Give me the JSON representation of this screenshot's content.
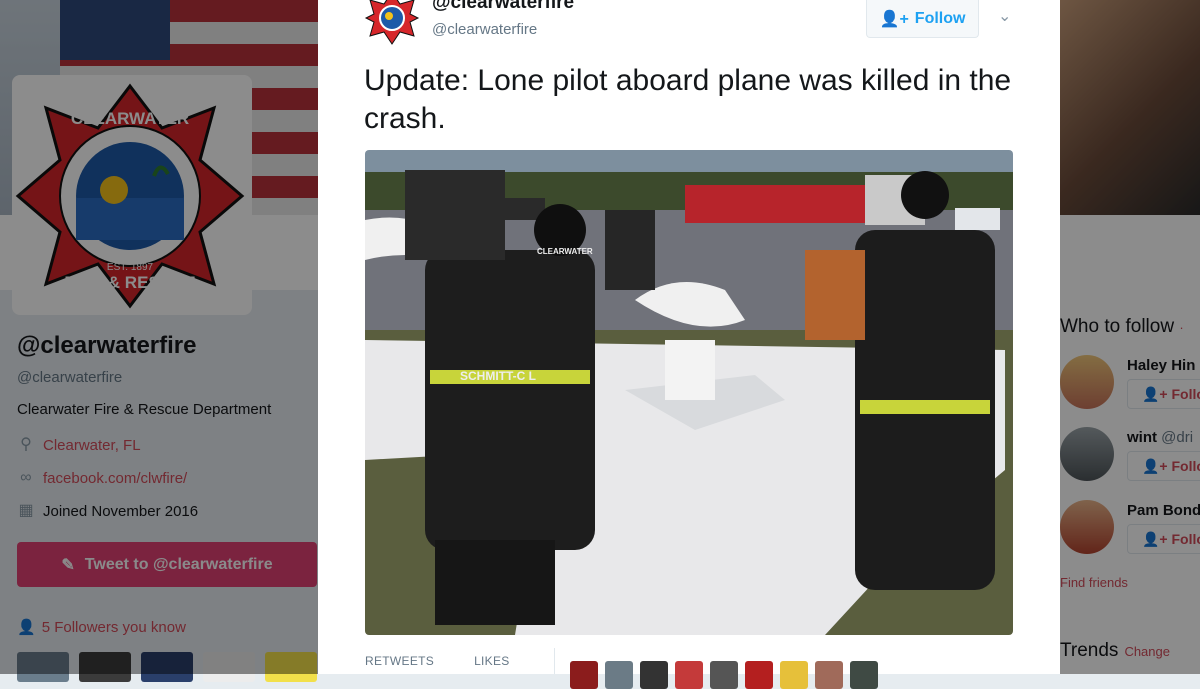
{
  "profile": {
    "name": "@clearwaterfire",
    "handle": "@clearwaterfire",
    "bio": "Clearwater Fire & Rescue Department",
    "location": "Clearwater, FL",
    "website": "facebook.com/clwfire/",
    "joined": "Joined November 2016",
    "tweet_to": "Tweet to @clearwaterfire",
    "followers_you_know": "5 Followers you know"
  },
  "logo": {
    "top_text": "CLEARWATER",
    "est": "EST. 1897",
    "bottom_text": "FIRE & RESCUE"
  },
  "sidebar": {
    "who_to_follow": "Who to follow",
    "who_to_follow_link": "·",
    "suggestions": [
      {
        "name": "Haley Hin",
        "handle": "",
        "follow": "Follo"
      },
      {
        "name": "wint",
        "handle": "@dri",
        "follow": "Follo"
      },
      {
        "name": "Pam Bond",
        "handle": "",
        "follow": "Follo"
      }
    ],
    "find_friends": "Find friends",
    "trends": "Trends",
    "trends_change": "Change"
  },
  "tweet": {
    "name": "@clearwaterfire",
    "handle": "@clearwaterfire",
    "follow_label": "Follow",
    "text": "Update: Lone pilot aboard plane was killed in the crash.",
    "photo_labels": {
      "helmet_name": "CLEARWATER",
      "jacket_name": "SCHMITT-C L"
    },
    "stats": {
      "retweets_label": "RETWEETS",
      "likes_label": "LIKES"
    }
  },
  "colors": {
    "accent": "#e0245e",
    "link": "#d14b5a",
    "twitter_blue": "#1da1f2"
  }
}
